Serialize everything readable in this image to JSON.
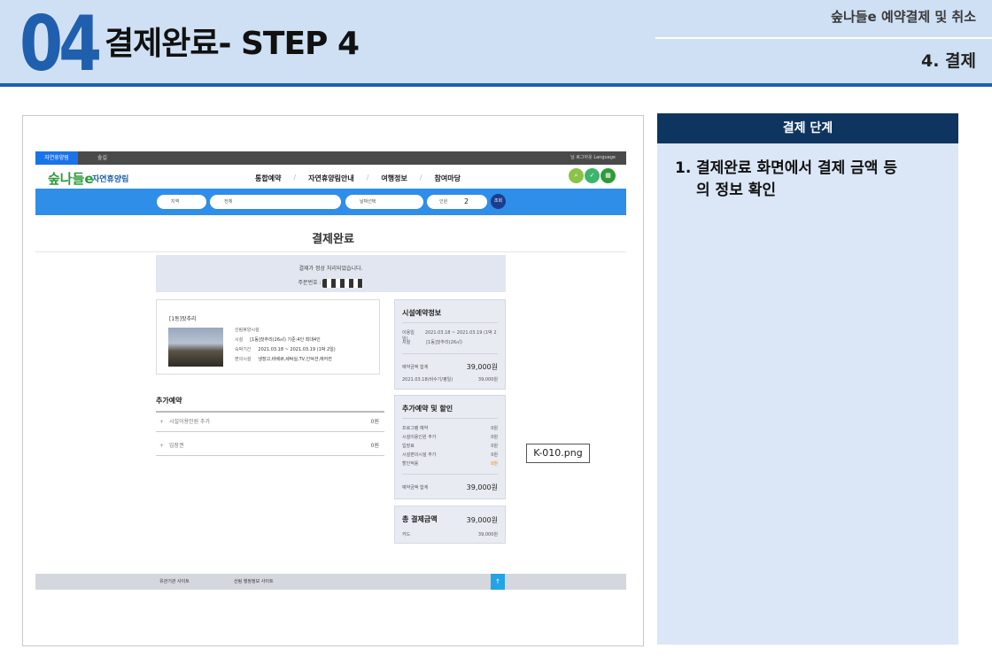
{
  "header": {
    "number": "04",
    "title": "결제완료- STEP 4",
    "right_top": "숲나들e 예약결제 및 취소",
    "right_bottom": "4. 결제"
  },
  "screenshot": {
    "topbar": {
      "tab1": "자연휴양림",
      "tab2": "숲길",
      "right": "님   로그아웃   Language"
    },
    "logo": "숲나들e",
    "site_name": "자연휴양림",
    "nav": [
      "통합예약",
      "자연휴양림안내",
      "여행정보",
      "참여마당"
    ],
    "search": {
      "region": "지역",
      "forest": "전체",
      "date": "날짜선택",
      "people_label": "인원",
      "people_count": "2",
      "submit": "조회"
    },
    "page_title": "결제완료",
    "message": {
      "line1": "결제가 정상 처리되었습니다.",
      "order_label": "주문번호 :"
    },
    "facility": {
      "name": "[1동]잣추리",
      "rows": [
        {
          "label": "산림휴양시설",
          "value": ""
        },
        {
          "label": "시설",
          "value": "[1동]잣추리(26㎡) 기준:4인 최대4인"
        },
        {
          "label": "숙박기간",
          "value": "2021.03.18 ~ 2021.03.19 (1박 2일)"
        },
        {
          "label": "편의시설",
          "value": "냉장고,바베큐,세탁실,TV,인덕션,에어컨"
        }
      ]
    },
    "additional": {
      "title": "추가예약",
      "rows": [
        {
          "label": "시설이용인원 추가",
          "value": "0원"
        },
        {
          "label": "입장권",
          "value": "0원"
        }
      ]
    },
    "facility_info": {
      "title": "시설예약정보",
      "rows": [
        {
          "label": "이용일",
          "value": "2021.03.18 ~ 2021.03.19 (1박 2일)"
        },
        {
          "label": "시설",
          "value": "[1동]잣추리(26㎡)"
        }
      ],
      "total_label": "예약금액 합계",
      "total_value": "39,000원",
      "detail_label": "2021.03.18(비수기/평일)",
      "detail_value": "39,000원"
    },
    "discount": {
      "title": "추가예약 및 할인",
      "rows": [
        {
          "label": "프로그램 예약",
          "value": "0원"
        },
        {
          "label": "시설이용인원 추가",
          "value": "0원"
        },
        {
          "label": "입장료",
          "value": "0원"
        },
        {
          "label": "시설편의시설 추가",
          "value": "0원"
        },
        {
          "label": "할인적용",
          "value": "0원"
        }
      ],
      "total_label": "예약금액 합계",
      "total_value": "39,000원"
    },
    "total": {
      "title": "총 결제금액",
      "value": "39,000원",
      "card_label": "카드",
      "card_value": "39,000원"
    },
    "bottom": {
      "link1": "유관기관 사이트",
      "link2": "산림 행정정보 사이트",
      "up": "↑"
    },
    "file_label": "K-010.png"
  },
  "side": {
    "header": "결제 단계",
    "num": "1.",
    "line1": "결제완료 화면에서 결제 금액 등",
    "line2": "의 정보 확인"
  },
  "colors": {
    "accent": "#1f5fae",
    "side_header": "#0d3560",
    "side_body": "#dbe7f7",
    "search_bar": "#2f8ee8"
  }
}
